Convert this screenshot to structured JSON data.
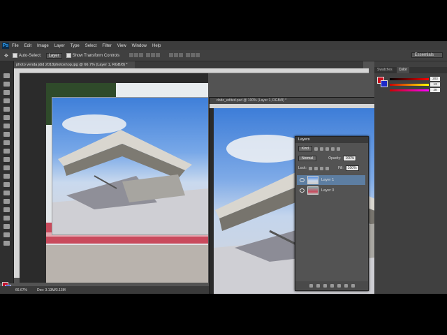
{
  "app": {
    "logo": "Ps",
    "menu": [
      "File",
      "Edit",
      "Image",
      "Layer",
      "Type",
      "Select",
      "Filter",
      "View",
      "Window",
      "Help"
    ]
  },
  "options_bar": {
    "auto_select_label": "Auto-Select:",
    "auto_select_target": "Layer",
    "show_transform_label": "Show Transform Controls",
    "workspace": "Essentials"
  },
  "document": {
    "tab_title": "photo venda jdid 2018photoshop.jpg @ 66.7% (Layer 1, RGB/8) *",
    "zoom": "66.67%",
    "doc_size": "Doc: 3.13M/3.13M"
  },
  "floating_window": {
    "title": "dodo_edited.psd @ 100% (Layer 1, RGB/8) *"
  },
  "color_panel": {
    "tabs": [
      "Swatches",
      "Color"
    ],
    "active_tab": "Color",
    "r": "203",
    "g": "13",
    "b": "28",
    "fg_hex": "#cb0d1c",
    "bg_hex": "#1e2bc8"
  },
  "layers_panel": {
    "title": "Layers",
    "filter_kind": "Kind",
    "blend_mode": "Normal",
    "opacity_label": "Opacity:",
    "opacity_value": "100%",
    "lock_label": "Lock:",
    "fill_label": "Fill:",
    "fill_value": "100%",
    "layers": [
      {
        "name": "Layer 1",
        "selected": true
      },
      {
        "name": "Layer 0",
        "selected": false
      }
    ]
  },
  "icons": [
    "move-tool-icon",
    "marquee-tool-icon",
    "lasso-tool-icon",
    "quick-select-icon",
    "crop-icon",
    "eyedropper-icon",
    "healing-brush-icon",
    "brush-icon",
    "clone-stamp-icon",
    "eraser-icon",
    "gradient-icon",
    "blur-icon",
    "dodge-icon",
    "pen-icon",
    "type-icon",
    "path-select-icon",
    "shape-icon",
    "hand-icon",
    "zoom-icon",
    "eye-icon",
    "link-icon",
    "fx-icon",
    "mask-icon",
    "adjustment-icon",
    "folder-icon",
    "new-layer-icon",
    "trash-icon"
  ]
}
